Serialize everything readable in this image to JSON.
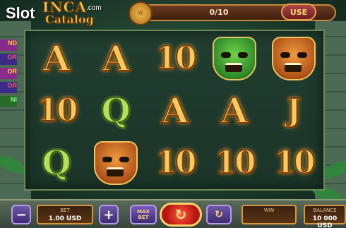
{
  "header": {
    "logo_slot": "Slot",
    "logo_com": ".com",
    "logo_catalog": "Catalog",
    "game_title_inca": "INCA",
    "bonus_icon": "idol-coin-icon",
    "bonus_count": "0/10",
    "use_label": "USE"
  },
  "side_labels": [
    "ND",
    "OR",
    "OR",
    "OR",
    "NI"
  ],
  "reels": [
    [
      {
        "kind": "letter",
        "text": "A",
        "style": "gold"
      },
      {
        "kind": "letter",
        "text": "10",
        "style": "gold"
      },
      {
        "kind": "letter",
        "text": "Q",
        "style": "green"
      }
    ],
    [
      {
        "kind": "letter",
        "text": "A",
        "style": "gold"
      },
      {
        "kind": "letter",
        "text": "Q",
        "style": "green"
      },
      {
        "kind": "mask",
        "icon": "orange-jaguar-mask-icon"
      }
    ],
    [
      {
        "kind": "letter",
        "text": "10",
        "style": "gold"
      },
      {
        "kind": "letter",
        "text": "A",
        "style": "gold"
      },
      {
        "kind": "letter",
        "text": "10",
        "style": "gold"
      }
    ],
    [
      {
        "kind": "mask",
        "icon": "green-idol-mask-icon"
      },
      {
        "kind": "letter",
        "text": "A",
        "style": "gold"
      },
      {
        "kind": "letter",
        "text": "10",
        "style": "gold"
      }
    ],
    [
      {
        "kind": "mask",
        "icon": "orange-jaguar-mask-icon"
      },
      {
        "kind": "letter",
        "text": "J",
        "style": "gold"
      },
      {
        "kind": "letter",
        "text": "10",
        "style": "gold"
      }
    ]
  ],
  "controls": {
    "minus_label": "−",
    "bet_label": "BET",
    "bet_value": "1.00 USD",
    "plus_label": "+",
    "max_bet_label_1": "MAX",
    "max_bet_label_2": "BET",
    "spin_icon": "spin-arrows-icon",
    "spin_glyph": "↻",
    "autoplay_icon": "autoplay-icon",
    "autoplay_glyph": "↻",
    "win_label": "WIN",
    "win_value": "",
    "balance_label": "BALANCE",
    "balance_value": "10 000 USD"
  },
  "colors": {
    "gold_symbol": "#f7c95a",
    "green_symbol": "#b6e05a",
    "spin_button": "#d62a18",
    "button_purple": "#5a46a0"
  }
}
